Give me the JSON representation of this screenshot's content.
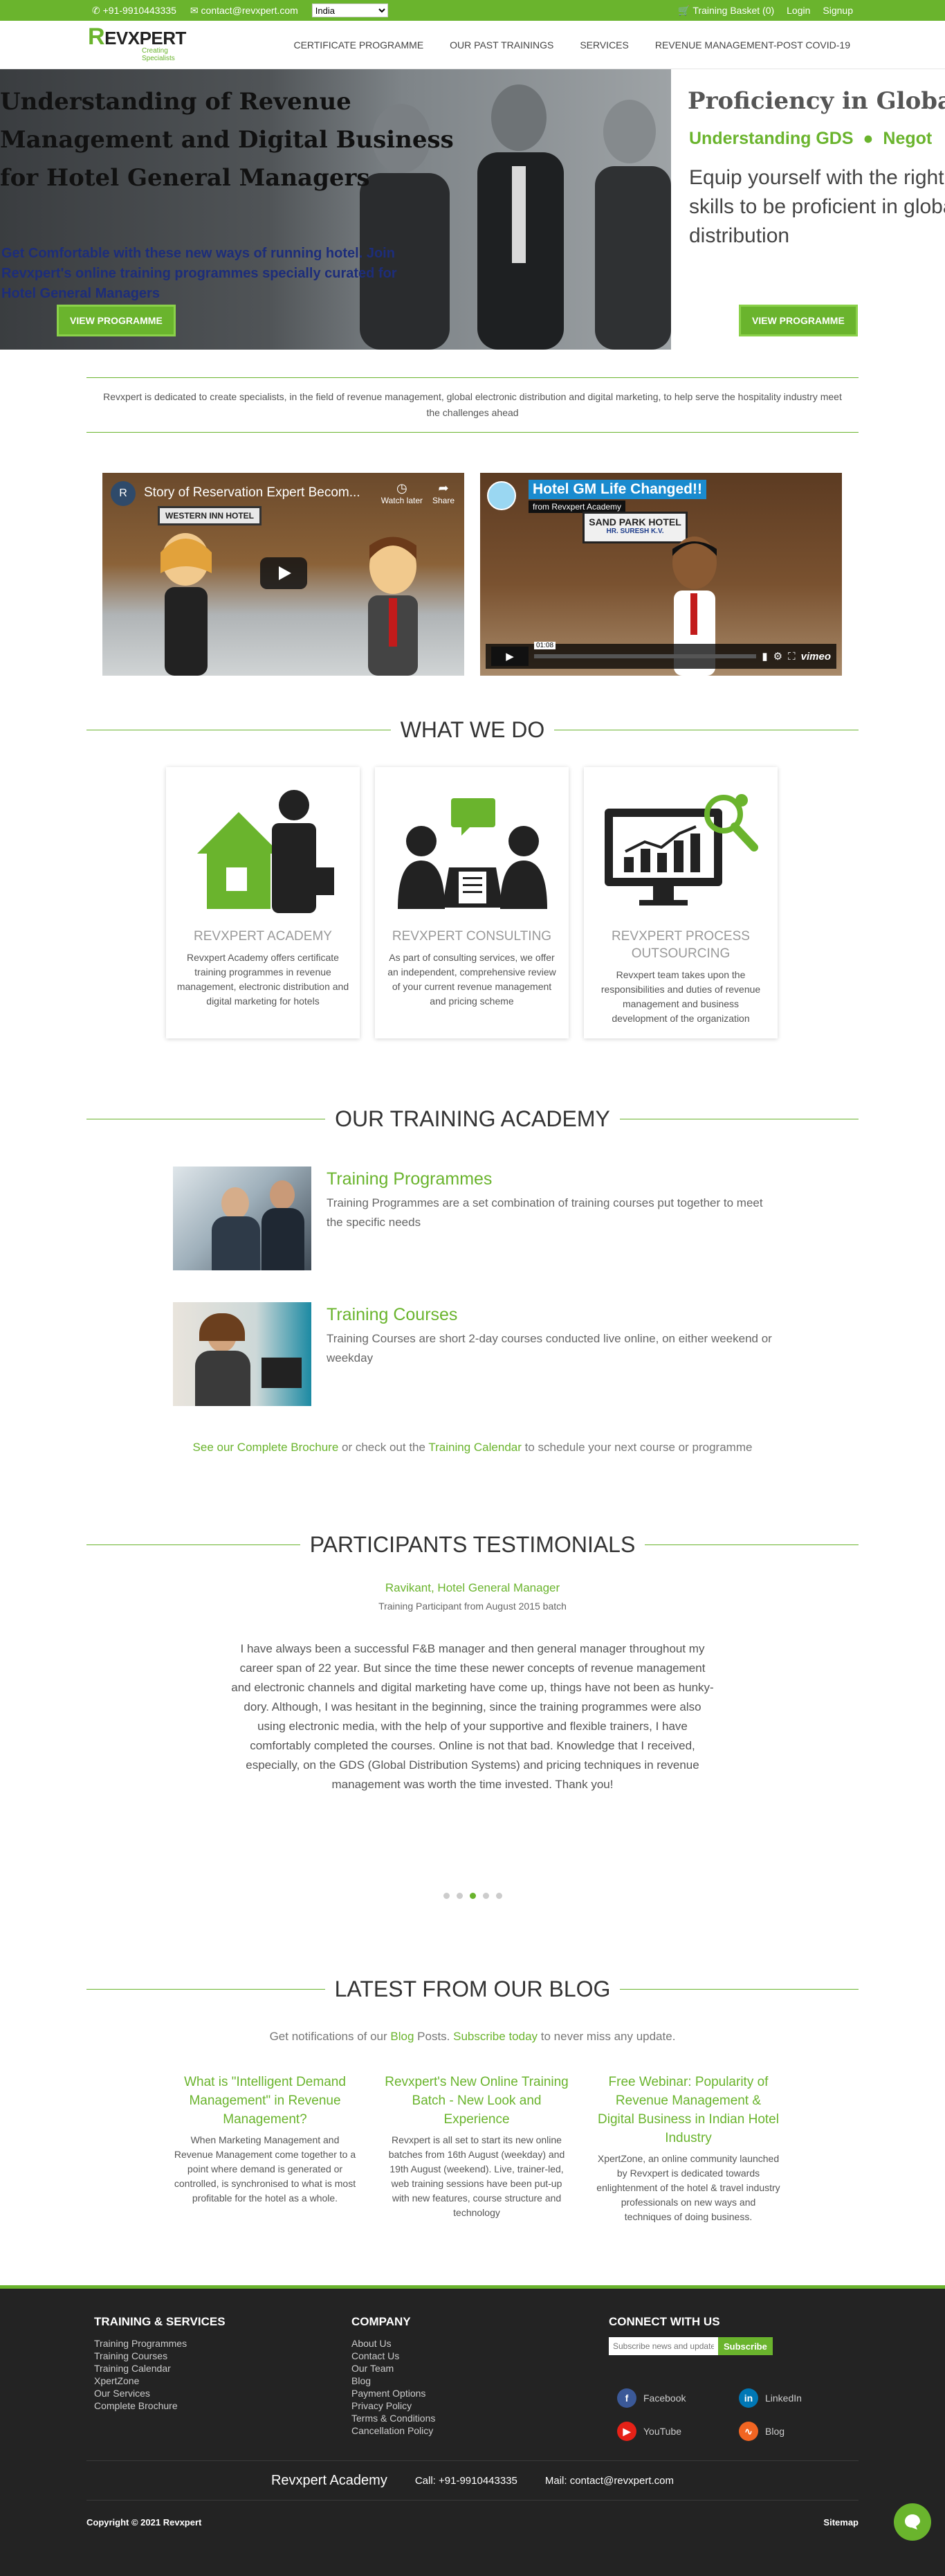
{
  "topbar": {
    "phone": "+91-9910443335",
    "email": "contact@revxpert.com",
    "country": "India",
    "basket": "Training Basket (0)",
    "login": "Login",
    "signup": "Signup"
  },
  "header": {
    "logo_text": "EVXPERT",
    "logo_letter": "R",
    "logo_tag": "Creating Specialists",
    "nav": [
      "CERTIFICATE PROGRAMME",
      "OUR PAST TRAININGS",
      "SERVICES",
      "REVENUE MANAGEMENT-POST COVID-19"
    ]
  },
  "hero": {
    "slide1_title": "Understanding of Revenue Management and Digital Business for Hotel General Managers",
    "slide1_sub": "Get Comfortable with these new ways of running hotel. Join Revxpert's online training programmes specially curated for Hotel General Managers",
    "slide1_button": "VIEW PROGRAMME",
    "slide2_title": "Proficiency in Global Distribution",
    "slide2_sub1": "Understanding GDS",
    "slide2_sub2": "Negot",
    "slide2_text": "Equip yourself with the right skills to be proficient in global distribution",
    "slide2_button": "VIEW PROGRAMME"
  },
  "intro": "Revxpert is dedicated to create specialists, in the field of revenue management, global electronic distribution and digital marketing, to help serve the hospitality industry meet the challenges ahead",
  "videos": {
    "v1_title": "Story of Reservation Expert Becom...",
    "v1_avatar": "R",
    "v1_watch": "Watch later",
    "v1_share": "Share",
    "v1_sign": "WESTERN INN HOTEL",
    "v2_title": "Hotel GM Life Changed!!",
    "v2_from": "from Revxpert Academy",
    "v2_sign": "SAND PARK HOTEL",
    "v2_name": "HR. SURESH K.V.",
    "v2_time": "01:08",
    "v2_vimeo": "vimeo"
  },
  "what_we_do": {
    "heading": "WHAT WE DO",
    "cards": [
      {
        "title": "REVXPERT ACADEMY",
        "text": "Revxpert Academy offers certificate training programmes in revenue management, electronic distribution and digital marketing for hotels"
      },
      {
        "title": "REVXPERT CONSULTING",
        "text": "As part of consulting services, we offer an independent, comprehensive review of your current revenue management and pricing scheme"
      },
      {
        "title": "REVXPERT PROCESS OUTSOURCING",
        "text": "Revxpert team takes upon the responsibilities and duties of revenue management and business development of the organization"
      }
    ]
  },
  "academy": {
    "heading": "OUR TRAINING ACADEMY",
    "items": [
      {
        "title": "Training Programmes",
        "text": "Training Programmes are a set combination of training courses put together to meet the specific needs"
      },
      {
        "title": "Training Courses",
        "text": "Training Courses are short 2-day courses conducted live online, on either weekend or weekday"
      }
    ],
    "brochure_link": "See our Complete Brochure",
    "brochure_mid": " or check out the ",
    "calendar_link": "Training Calendar",
    "brochure_end": " to schedule your next course or programme"
  },
  "testimonials": {
    "heading": "PARTICIPANTS TESTIMONIALS",
    "name": "Ravikant, Hotel General Manager",
    "role": "Training Participant from August 2015 batch",
    "quote": "I have always been a successful F&B manager and then general manager throughout my career span of 22 year. But since the time these newer concepts of revenue management and electronic channels and digital marketing have come up, things have not been as hunky-dory. Although, I was hesitant in the beginning, since the training programmes were also using electronic media, with the help of your supportive and flexible trainers, I have comfortably completed the courses. Online is not that bad. Knowledge that I received, especially, on the GDS (Global Distribution Systems) and pricing techniques in revenue management was worth the time invested. Thank you!"
  },
  "blog": {
    "heading": "LATEST FROM OUR BLOG",
    "sub_a": "Get notifications of our ",
    "sub_blog": "Blog",
    "sub_b": " Posts. ",
    "sub_link": "Subscribe today",
    "sub_c": " to never miss any update.",
    "posts": [
      {
        "title": "What is \"Intelligent Demand Management\" in Revenue Management?",
        "text": "When Marketing Management and Revenue Management come together to a point where demand is generated or controlled, is synchronised to what is most profitable for the hotel as a whole."
      },
      {
        "title": "Revxpert's New Online Training Batch - New Look and Experience",
        "text": "Revxpert is all set to start its new online batches from 16th August (weekday) and 19th August (weekend). Live, trainer-led, web training sessions have been put-up with new features, course structure and technology"
      },
      {
        "title": "Free Webinar: Popularity of Revenue Management & Digital Business in Indian Hotel Industry",
        "text": "XpertZone, an online community launched by Revxpert is dedicated towards enlightenment of the hotel & travel industry professionals on new ways and techniques of doing business."
      }
    ]
  },
  "footer": {
    "col1_title": "TRAINING & SERVICES",
    "col1": [
      "Training Programmes",
      "Training Courses",
      "Training Calendar",
      "XpertZone",
      "Our Services",
      "Complete Brochure"
    ],
    "col2_title": "COMPANY",
    "col2": [
      "About Us",
      "Contact Us",
      "Our Team",
      "Blog",
      "Payment Options",
      "Privacy Policy",
      "Terms & Conditions",
      "Cancellation Policy"
    ],
    "col3_title": "CONNECT WITH US",
    "subscribe_placeholder": "Subscribe news and updates",
    "subscribe_button": "Subscribe",
    "social": [
      "Facebook",
      "LinkedIn",
      "YouTube",
      "Blog"
    ],
    "brand": "Revxpert Academy",
    "call": "Call: +91-9910443335",
    "mail": "Mail: contact@revxpert.com",
    "copyright": "Copyright © 2021 Revxpert",
    "sitemap": "Sitemap"
  },
  "colors": {
    "accent": "#6ab42d",
    "footer_bg": "#232323",
    "hero_sub": "#1d2d7a"
  }
}
